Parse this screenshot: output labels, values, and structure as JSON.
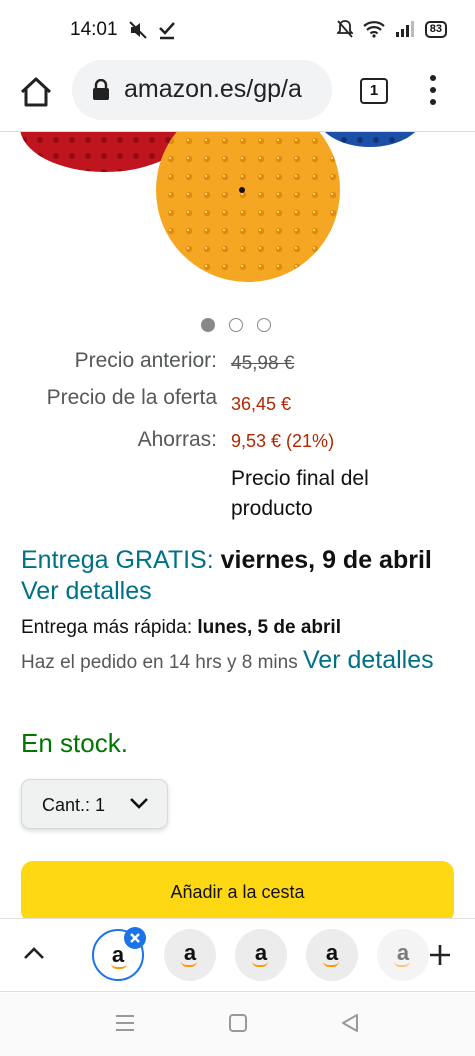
{
  "status_bar": {
    "time": "14:01",
    "battery": "83",
    "icons": [
      "mute-icon",
      "download-done-icon",
      "bell-off-icon",
      "wifi-icon",
      "signal-icon",
      "battery-icon"
    ]
  },
  "browser": {
    "url": "amazon.es/gp/a",
    "tab_count": "1",
    "icons": [
      "home-icon",
      "lock-icon",
      "tabs-icon",
      "more-vert-icon"
    ]
  },
  "carousel": {
    "total": 3,
    "active": 1
  },
  "pricing": {
    "previous_label": "Precio anterior:",
    "previous_value": "45,98 €",
    "deal_label": "Precio de la oferta",
    "deal_value": "36,45 €",
    "savings_label": "Ahorras:",
    "savings_value": "9,53 € (21%)",
    "final_note": "Precio final del producto"
  },
  "delivery": {
    "free_prefix": "Entrega GRATIS:",
    "free_date": "viernes, 9 de abril",
    "details_link": "Ver detalles",
    "fast_prefix": "Entrega más rápida:",
    "fast_date": "lunes, 5 de abril",
    "order_within": "Haz el pedido en 14 hrs y 8 mins",
    "details_link_2": "Ver detalles"
  },
  "stock": "En stock.",
  "quantity": {
    "label": "Cant.:",
    "value": "1"
  },
  "add_to_cart": "Añadir a la cesta",
  "tab_strip": {
    "favicon_glyph": "a",
    "tab_count_visible": 5
  },
  "colors": {
    "price_red": "#b12704",
    "link_teal": "#007185",
    "stock_green": "#007600",
    "cart_yellow": "#ffd814",
    "active_tab_blue": "#1a73e8",
    "ball_orange": "#f5a623",
    "ball_red": "#c0141f",
    "ball_blue": "#1b4fa8"
  }
}
